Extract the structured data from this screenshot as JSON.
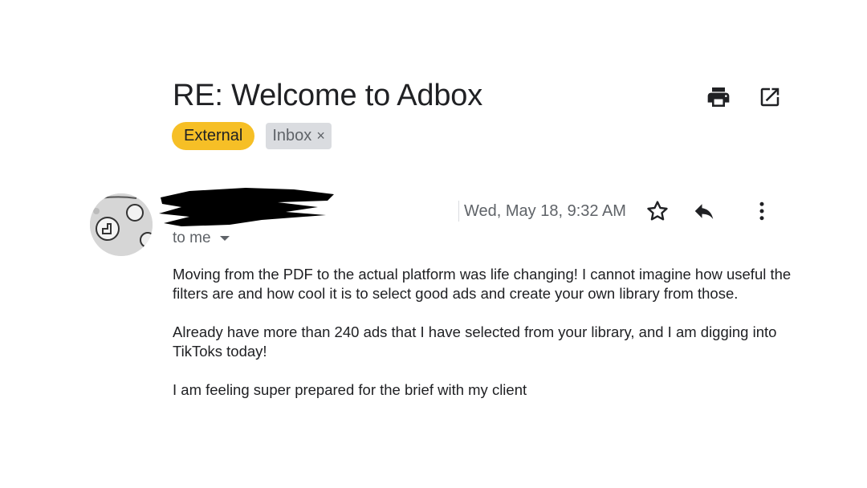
{
  "email": {
    "subject": "RE: Welcome to Adbox",
    "labels": {
      "external": "External",
      "inbox": "Inbox",
      "inbox_remove": "×"
    },
    "date": "Wed, May 18, 9:32 AM",
    "recipient": "to me",
    "body": [
      "Moving from the PDF to the actual platform was life changing! I cannot imagine how useful the filters are and how cool it is to select good ads and create your own library from those.",
      "Already have more than 240 ads that I have selected from your library, and I am digging into TikToks today!",
      "I am feeling super prepared for the brief with my client"
    ]
  },
  "icons": {
    "print": "print-icon",
    "open_new_window": "open-in-new-icon",
    "star": "star-icon",
    "reply": "reply-icon",
    "more": "more-vert-icon",
    "dropdown": "arrow-drop-down-icon"
  },
  "colors": {
    "external_label": "#f6bf26",
    "inbox_label": "#dadce0",
    "text": "#202124",
    "secondary_text": "#5f6368"
  }
}
